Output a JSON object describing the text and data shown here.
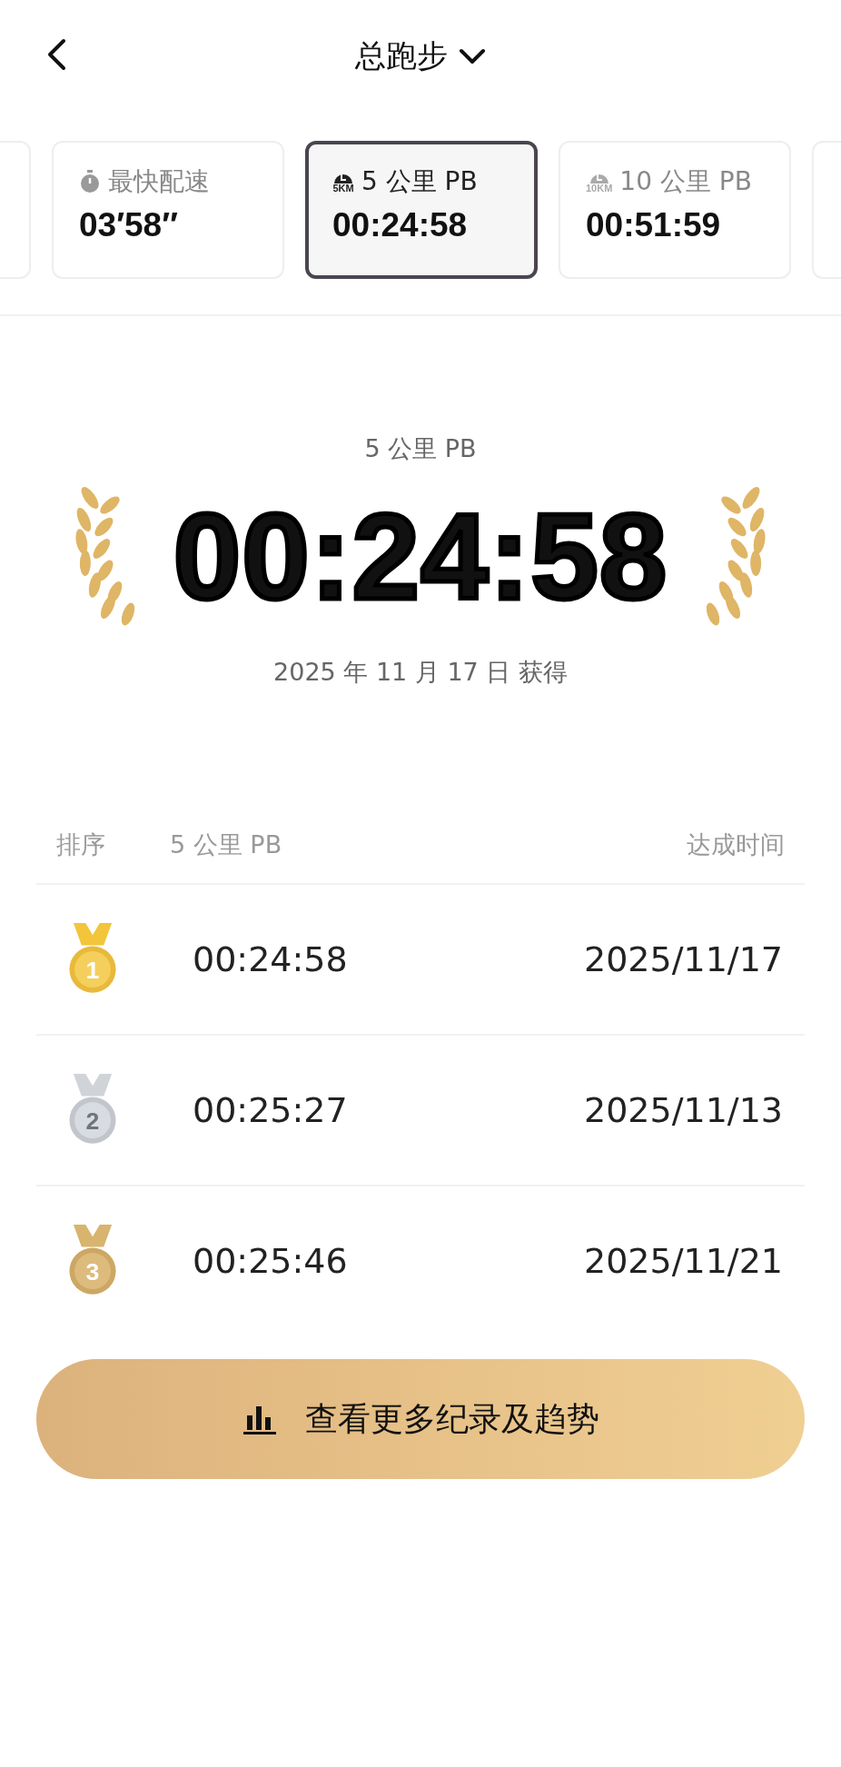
{
  "header": {
    "title": "总跑步"
  },
  "cards": [
    {
      "kind": "partial"
    },
    {
      "kind": "stopwatch",
      "label": "最快配速",
      "value": "03′58″",
      "selected": false
    },
    {
      "kind": "distance",
      "badge": "5KM",
      "label": "5 公里 PB",
      "value": "00:24:58",
      "selected": true
    },
    {
      "kind": "distance",
      "badge": "10KM",
      "label": "10 公里 PB",
      "value": "00:51:59",
      "selected": false
    },
    {
      "kind": "partial"
    }
  ],
  "record": {
    "label": "5 公里 PB",
    "time": "00:24:58",
    "date": "2025 年 11 月 17 日 获得"
  },
  "table": {
    "columns": [
      "排序",
      "5 公里 PB",
      "达成时间"
    ],
    "rows": [
      {
        "kind": "gold",
        "rank": "1",
        "time": "00:24:58",
        "date": "2025/11/17"
      },
      {
        "kind": "silver",
        "rank": "2",
        "time": "00:25:27",
        "date": "2025/11/13"
      },
      {
        "kind": "bronze",
        "rank": "3",
        "time": "00:25:46",
        "date": "2025/11/21"
      }
    ]
  },
  "button": {
    "label": "查看更多纪录及趋势"
  }
}
